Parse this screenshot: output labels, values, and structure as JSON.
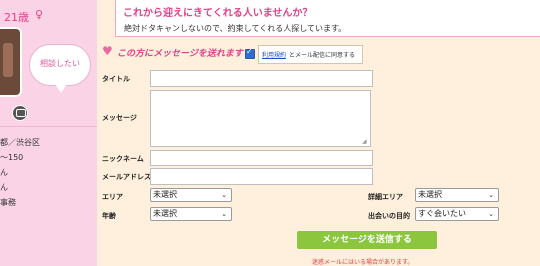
{
  "profile": {
    "age": "21歳",
    "gender_symbol": "♀",
    "bubble_text": "相談したい",
    "info_lines": [
      "都／渋谷区",
      "〜150",
      "ん",
      "ん",
      "事務"
    ]
  },
  "header": {
    "title": "これから迎えにきてくれる人いませんか？",
    "subtitle": "絶対ドタキャンしないので、約束してくれる人探しています。"
  },
  "lead": {
    "text": "この方にメッセージを送れます",
    "agree_terms_link": "利用規約",
    "agree_rest": "とメール配信に同意する",
    "agree_checked": true
  },
  "form": {
    "title_label": "タイトル",
    "title_value": "",
    "message_label": "メッセージ",
    "message_value": "",
    "nickname_label": "ニックネーム",
    "nickname_value": "",
    "email_label": "メールアドレス",
    "email_value": "",
    "area_label": "エリア",
    "area_value": "未選択",
    "detail_area_label": "詳細エリア",
    "detail_area_value": "未選択",
    "age_label": "年齢",
    "age_value": "未選択",
    "purpose_label": "出会いの目的",
    "purpose_value": "すぐ会いたい"
  },
  "submit": {
    "label": "メッセージを送信する",
    "warning": "迷惑メールにはいる場合があります。"
  },
  "colors": {
    "accent_pink": "#e0428a",
    "panel_pink": "#fbd3e6",
    "form_bg": "#fff0dd",
    "submit_green": "#8cc63f",
    "warning_red": "#e03b3b"
  }
}
